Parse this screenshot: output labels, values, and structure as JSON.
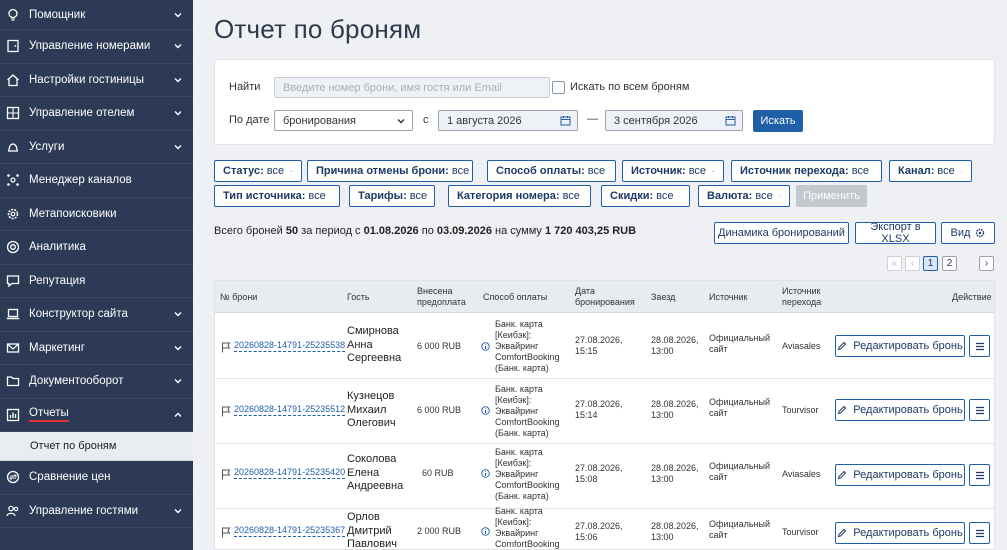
{
  "sidebar": {
    "items": [
      {
        "label": "Помощник",
        "icon": "lightbulb-icon"
      },
      {
        "label": "Управление номерами",
        "icon": "door-icon"
      },
      {
        "label": "Настройки гостиницы",
        "icon": "house-icon"
      },
      {
        "label": "Управление отелем",
        "icon": "grid-icon"
      },
      {
        "label": "Услуги",
        "icon": "bell-icon"
      },
      {
        "label": "Менеджер каналов",
        "icon": "network-icon"
      },
      {
        "label": "Метапоисковики",
        "icon": "gear-icon"
      },
      {
        "label": "Аналитика",
        "icon": "target-icon"
      },
      {
        "label": "Репутация",
        "icon": "chat-icon"
      },
      {
        "label": "Конструктор сайта",
        "icon": "laptop-icon"
      },
      {
        "label": "Маркетинг",
        "icon": "mail-icon"
      },
      {
        "label": "Документооборот",
        "icon": "folder-icon"
      },
      {
        "label": "Отчеты",
        "icon": "chart-icon"
      }
    ],
    "sub_item": "Отчет по броням",
    "after": [
      {
        "label": "Сравнение цен",
        "icon": "compare-icon"
      },
      {
        "label": "Управление гостями",
        "icon": "users-icon"
      }
    ]
  },
  "page": {
    "title": "Отчет по броням"
  },
  "filters": {
    "find_label": "Найти",
    "search_placeholder": "Введите номер брони, имя гостя или Email",
    "search_all_label": "Искать по всем броням",
    "by_date_label": "По дате",
    "date_type": "бронирования",
    "from_label": "с",
    "date_from": "1 августа 2026",
    "dash": "—",
    "date_to": "3 сентября 2026",
    "search_button": "Искать"
  },
  "chips": [
    {
      "name": "Статус:",
      "value": "все"
    },
    {
      "name": "Причина отмены брони:",
      "value": "все"
    },
    {
      "name": "Способ оплаты:",
      "value": "все"
    },
    {
      "name": "Источник:",
      "value": "все"
    },
    {
      "name": "Источник перехода:",
      "value": "все"
    },
    {
      "name": "Канал:",
      "value": "все"
    },
    {
      "name": "Тип источника:",
      "value": "все"
    },
    {
      "name": "Тарифы:",
      "value": "все"
    },
    {
      "name": "Категория номера:",
      "value": "все"
    },
    {
      "name": "Скидки:",
      "value": "все"
    },
    {
      "name": "Валюта:",
      "value": "все"
    }
  ],
  "apply_button": "Применить",
  "summary": {
    "prefix": "Всего броней",
    "count": "50",
    "period_text": "за период с",
    "from": "01.08.2026",
    "to_text": "по",
    "to": "03.09.2026",
    "sum_text": "на сумму",
    "sum": "1 720 403,25 RUB"
  },
  "actions": {
    "dynamics": "Динамика бронирований",
    "export": "Экспорт в XLSX",
    "view": "Вид"
  },
  "pagination": {
    "first": "«",
    "prev": "‹",
    "page1": "1",
    "page2": "2",
    "next": "›"
  },
  "table": {
    "headers": {
      "booking": "№ брони",
      "guest": "Гость",
      "prepaid_1": "Внесена",
      "prepaid_2": "предоплата",
      "payment": "Способ оплаты",
      "date_1": "Дата",
      "date_2": "бронирования",
      "checkin": "Заезд",
      "source": "Источник",
      "referral_1": "Источник",
      "referral_2": "перехода",
      "action": "Действие"
    },
    "rows": [
      {
        "booking": "20260828-14791-25235538",
        "guest_1": "Смирнова",
        "guest_2": "Анна",
        "guest_3": "Сергеевна",
        "prepaid": "6 000 RUB",
        "pay_1": "Банк. карта",
        "pay_2": "[Кеибэк]:",
        "pay_3": "Эквайринг",
        "pay_4": "ComfortBooking",
        "pay_5": "(Банк. карта)",
        "date_1": "27.08.2026,",
        "date_2": "15:15",
        "checkin_1": "28.08.2026,",
        "checkin_2": "13:00",
        "source_1": "Официальный",
        "source_2": "сайт",
        "referral": "Aviasales",
        "edit": "Редактировать бронь"
      },
      {
        "booking": "20260828-14791-25235512",
        "guest_1": "Кузнецов",
        "guest_2": "Михаил",
        "guest_3": "Олегович",
        "prepaid": "6 000 RUB",
        "pay_1": "Банк. карта",
        "pay_2": "[Кеибэк]:",
        "pay_3": "Эквайринг",
        "pay_4": "ComfortBooking",
        "pay_5": "(Банк. карта)",
        "date_1": "27.08.2026,",
        "date_2": "15:14",
        "checkin_1": "28.08.2026,",
        "checkin_2": "13:00",
        "source_1": "Официальный",
        "source_2": "сайт",
        "referral": "Tourvisor",
        "edit": "Редактировать бронь"
      },
      {
        "booking": "20260828-14791-25235420",
        "guest_1": "Соколова",
        "guest_2": "Елена",
        "guest_3": "Андреевна",
        "prepaid": "60 RUB",
        "pay_1": "Банк. карта",
        "pay_2": "[Кеибэк]:",
        "pay_3": "Эквайринг",
        "pay_4": "ComfortBooking",
        "pay_5": "(Банк. карта)",
        "date_1": "27.08.2026,",
        "date_2": "15:08",
        "checkin_1": "28.08.2026,",
        "checkin_2": "13:00",
        "source_1": "Официальный",
        "source_2": "сайт",
        "referral": "Aviasales",
        "edit": "Редактировать бронь"
      },
      {
        "booking": "20260828-14791-25235367",
        "guest_1": "Орлов",
        "guest_2": "Дмитрий",
        "guest_3": "Павлович",
        "prepaid": "2 000 RUB",
        "pay_1": "Банк. карта",
        "pay_2": "[Кеибэк]:",
        "pay_3": "Эквайринг",
        "pay_4": "ComfortBooking",
        "pay_5": "",
        "date_1": "27.08.2026,",
        "date_2": "15:06",
        "checkin_1": "28.08.2026,",
        "checkin_2": "13:00",
        "source_1": "Официальный",
        "source_2": "сайт",
        "referral": "Tourvisor",
        "edit": "Редактировать бронь"
      }
    ]
  }
}
